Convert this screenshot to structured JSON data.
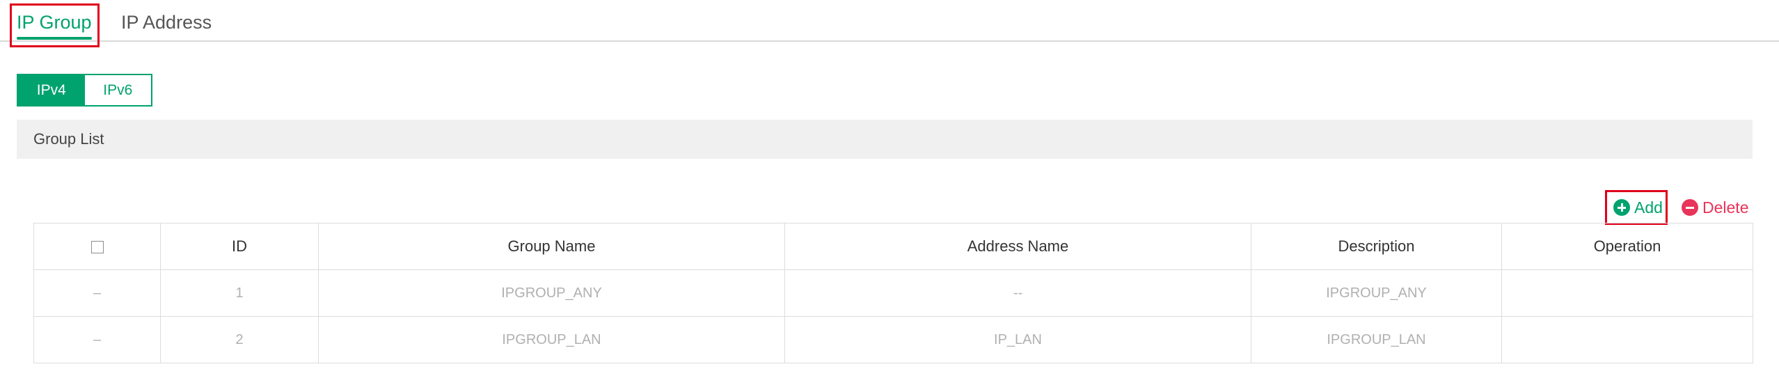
{
  "tabs": {
    "ip_group": "IP Group",
    "ip_address": "IP Address"
  },
  "ip_version": {
    "ipv4": "IPv4",
    "ipv6": "IPv6",
    "selected": "IPv4"
  },
  "section": {
    "title": "Group List"
  },
  "actions": {
    "add": "Add",
    "delete": "Delete"
  },
  "table": {
    "headers": {
      "select": "",
      "id": "ID",
      "group_name": "Group Name",
      "address_name": "Address Name",
      "description": "Description",
      "operation": "Operation"
    },
    "rows": [
      {
        "select": "–",
        "id": "1",
        "group_name": "IPGROUP_ANY",
        "address_name": "--",
        "description": "IPGROUP_ANY",
        "operation": ""
      },
      {
        "select": "–",
        "id": "2",
        "group_name": "IPGROUP_LAN",
        "address_name": "IP_LAN",
        "description": "IPGROUP_LAN",
        "operation": ""
      }
    ]
  },
  "colors": {
    "accent": "#00a26e",
    "danger": "#e8335a",
    "highlight": "#e0001b"
  },
  "icons": {
    "add": "plus-circle-icon",
    "delete": "minus-circle-icon"
  }
}
